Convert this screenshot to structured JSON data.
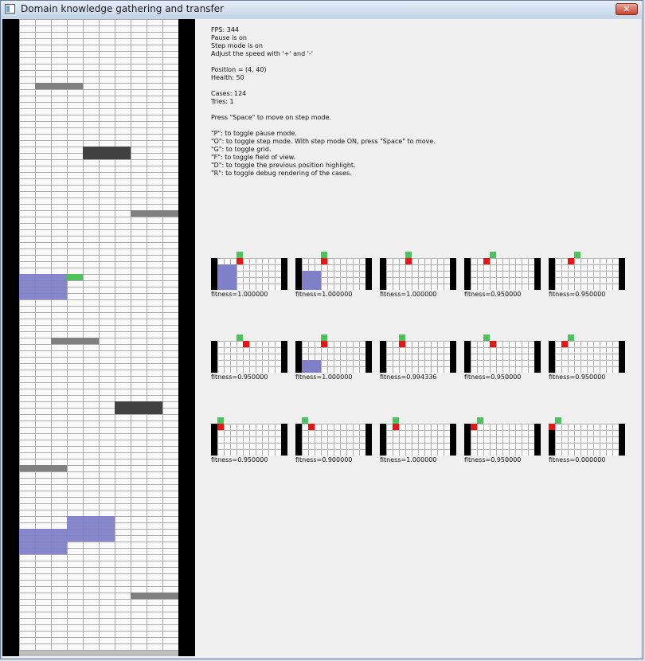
{
  "window": {
    "title": "Domain knowledge gathering and transfer",
    "close_label": "✕"
  },
  "info": {
    "fps": "FPS: 344",
    "pause": "Pause is on",
    "step": "Step mode is on",
    "speed": "Adjust the speed with '+' and '-'",
    "position": "Position = (4, 40)",
    "health": "Health: 50",
    "cases": "Cases: 124",
    "tries": "Tries: 1",
    "press_space": "Press \"Space\" to move on step mode.",
    "help_p": "\"P\": to toggle pause mode.",
    "help_o": "\"O\": to toggle step mode. With step mode ON, press \"Space\" to move.",
    "help_g": "\"G\": to toggle grid.",
    "help_f": "\"F\": to toggle field of view.",
    "help_d": "\"D\": to toggle the previous position highlight.",
    "help_r": "\"R\": to toggle debug rendering of the cases."
  },
  "cases": [
    {
      "fitness": "fitness=1.000000"
    },
    {
      "fitness": "fitness=1.000000"
    },
    {
      "fitness": "fitness=1.000000"
    },
    {
      "fitness": "fitness=0.950000"
    },
    {
      "fitness": "fitness=0.950000"
    },
    {
      "fitness": "fitness=0.950000"
    },
    {
      "fitness": "fitness=1.000000"
    },
    {
      "fitness": "fitness=0.994336"
    },
    {
      "fitness": "fitness=0.950000"
    },
    {
      "fitness": "fitness=0.950000"
    },
    {
      "fitness": "fitness=0.950000"
    },
    {
      "fitness": "fitness=0.900000"
    },
    {
      "fitness": "fitness=1.000000"
    },
    {
      "fitness": "fitness=0.950000"
    },
    {
      "fitness": "fitness=0.000000"
    }
  ],
  "colors": {
    "player": "#4dc25a",
    "target": "#e01818",
    "trail": "#8080c8",
    "platform": "#808080",
    "block": "#404040",
    "wall": "#000000"
  }
}
